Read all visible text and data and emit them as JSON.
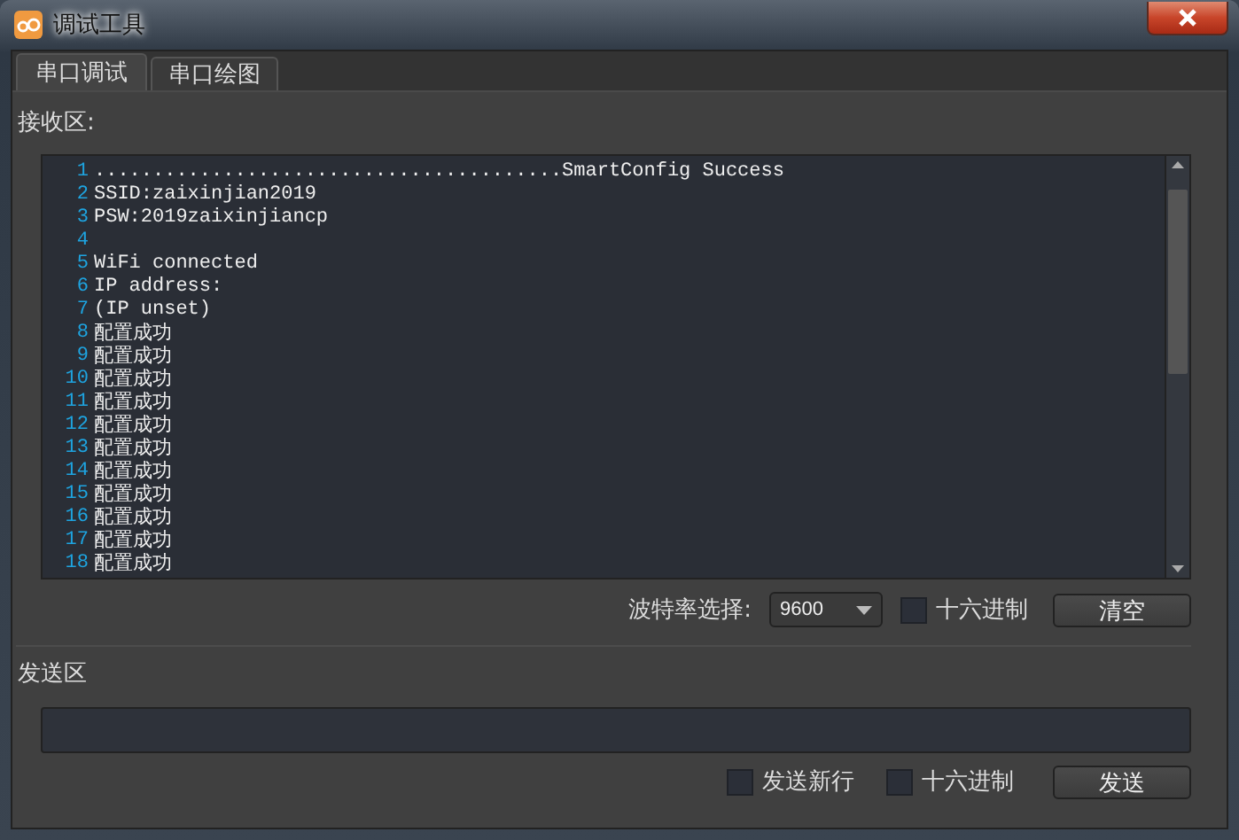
{
  "window": {
    "title": "调试工具"
  },
  "tabs": [
    {
      "label": "串口调试",
      "selected": true
    },
    {
      "label": "串口绘图",
      "selected": false
    }
  ],
  "receive": {
    "label": "接收区:",
    "lines": [
      {
        "number": "1",
        "text": "........................................SmartConfig Success"
      },
      {
        "number": "2",
        "text": "SSID:zaixinjian2019"
      },
      {
        "number": "3",
        "text": "PSW:2019zaixinjiancp"
      },
      {
        "number": "4"
      },
      {
        "number": "5",
        "text": "WiFi connected"
      },
      {
        "number": "6",
        "text": "IP address:"
      },
      {
        "number": "7",
        "text": "(IP unset)"
      },
      {
        "number": "8",
        "text": "配置成功"
      },
      {
        "number": "9",
        "text": "配置成功"
      },
      {
        "number": "10",
        "text": "配置成功"
      },
      {
        "number": "11",
        "text": "配置成功"
      },
      {
        "number": "12",
        "text": "配置成功"
      },
      {
        "number": "13",
        "text": "配置成功"
      },
      {
        "number": "14",
        "text": "配置成功"
      },
      {
        "number": "15",
        "text": "配置成功"
      },
      {
        "number": "16",
        "text": "配置成功"
      },
      {
        "number": "17",
        "text": "配置成功"
      },
      {
        "number": "18",
        "text": "配置成功"
      }
    ],
    "baud_label": "波特率选择:",
    "baud_value": "9600",
    "checkboxes": [
      {
        "label": "十六进制",
        "checked": false
      }
    ],
    "clear_button": "清空"
  },
  "send": {
    "label": "发送区",
    "checkboxes": [
      {
        "label": "发送新行",
        "checked": false
      },
      {
        "label": "十六进制",
        "checked": false
      }
    ],
    "send_button": "发送"
  }
}
